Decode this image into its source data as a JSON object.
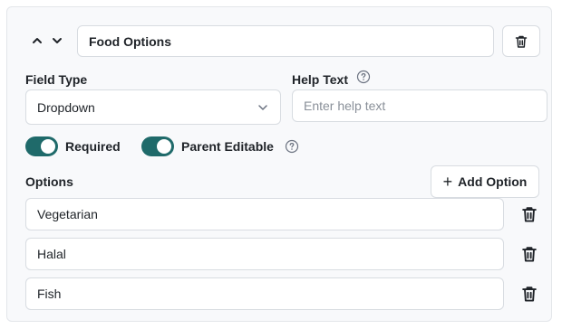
{
  "field": {
    "name": "Food Options",
    "field_type_label": "Field Type",
    "field_type_value": "Dropdown",
    "help_text_label": "Help Text",
    "help_text_placeholder": "Enter help text"
  },
  "toggles": {
    "required_label": "Required",
    "required_on": true,
    "parent_editable_label": "Parent Editable",
    "parent_editable_on": true
  },
  "options_section": {
    "label": "Options",
    "add_button_label": "Add Option",
    "items": [
      {
        "value": "Vegetarian"
      },
      {
        "value": "Halal"
      },
      {
        "value": "Fish"
      }
    ]
  },
  "icons": {
    "move_up": "chevron-up-icon",
    "move_down": "chevron-down-icon",
    "delete": "trash-icon",
    "info": "help-circle-icon",
    "dropdown": "chevron-down-icon",
    "add": "plus-icon"
  },
  "colors": {
    "toggle_on": "#1f6a6a",
    "card_bg": "#f8f9fb",
    "border": "#d8dce1"
  }
}
